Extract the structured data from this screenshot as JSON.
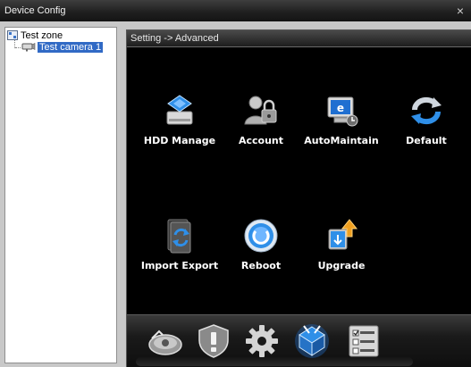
{
  "window": {
    "title": "Device Config",
    "close_glyph": "×"
  },
  "tree": {
    "root_label": "Test zone",
    "root_icon": "zone-icon",
    "child_label": "Test camera 1",
    "child_icon": "camera-icon",
    "selected": "Test camera 1"
  },
  "panel": {
    "breadcrumb": "Setting -> Advanced"
  },
  "tiles": [
    {
      "label": "HDD Manage",
      "icon": "hdd-icon"
    },
    {
      "label": "Account",
      "icon": "account-icon"
    },
    {
      "label": "AutoMaintain",
      "icon": "automaintain-icon"
    },
    {
      "label": "Default",
      "icon": "default-icon"
    },
    {
      "label": "Import Export",
      "icon": "import-export-icon"
    },
    {
      "label": "Reboot",
      "icon": "reboot-icon"
    },
    {
      "label": "Upgrade",
      "icon": "upgrade-icon"
    }
  ],
  "dock": [
    {
      "icon": "record-icon"
    },
    {
      "icon": "alarm-shield-icon"
    },
    {
      "icon": "system-gear-icon"
    },
    {
      "icon": "advanced-icon",
      "active": true
    },
    {
      "icon": "info-list-icon"
    }
  ],
  "colors": {
    "selection": "#316ac5",
    "panel_bg": "#000000",
    "accent_blue": "#2f8fe8"
  }
}
